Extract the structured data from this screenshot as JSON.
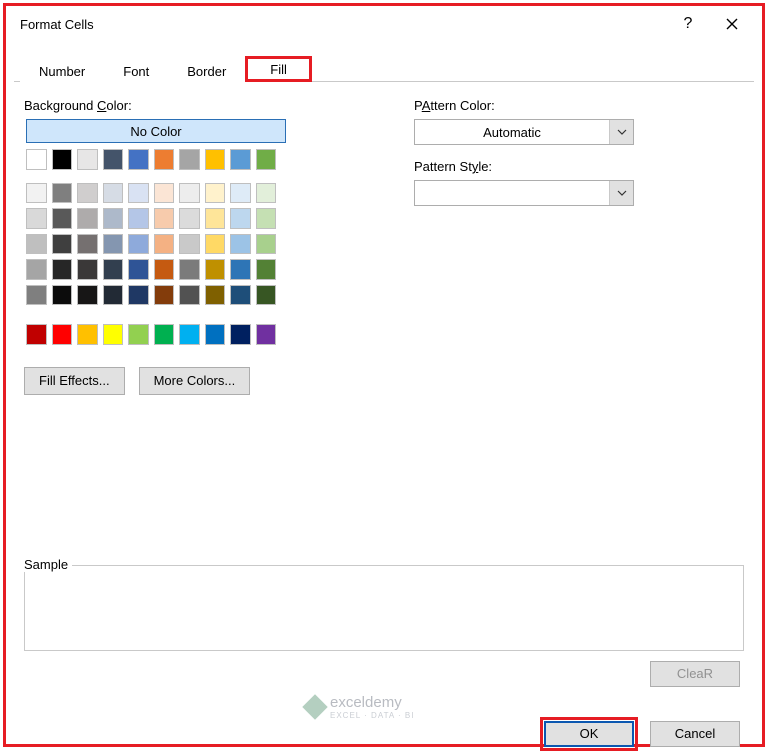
{
  "titlebar": {
    "title": "Format Cells",
    "help": "?",
    "close": "×"
  },
  "tabs": {
    "number": "Number",
    "font": "Font",
    "border": "Border",
    "fill": "Fill"
  },
  "left": {
    "bg_label_pre": "Background ",
    "bg_label_ul": "C",
    "bg_label_post": "olor:",
    "no_color": "No Color",
    "fill_effects_pre": "F",
    "fill_effects_ul": "i",
    "fill_effects_post": "ll Effects...",
    "more_colors_ul": "M",
    "more_colors_post": "ore Colors..."
  },
  "right": {
    "pattern_color_label": "Pattern Color:",
    "pattern_color_ul": "A",
    "pattern_color_value": "Automatic",
    "pattern_style_pre": "Pattern St",
    "pattern_style_ul": "y",
    "pattern_style_post": "le:",
    "pattern_style_value": ""
  },
  "sample": {
    "label": "Sample"
  },
  "buttons": {
    "clear_ul": "R",
    "clear_pre": "Clea",
    "clear_post": "",
    "ok": "OK",
    "cancel": "Cancel"
  },
  "watermark": {
    "name": "exceldemy",
    "sub": "EXCEL · DATA · BI"
  },
  "colors": {
    "theme_row": [
      "#ffffff",
      "#000000",
      "#e7e6e6",
      "#44546a",
      "#4472c4",
      "#ed7d31",
      "#a5a5a5",
      "#ffc000",
      "#5b9bd5",
      "#70ad47"
    ],
    "tints": [
      [
        "#f2f2f2",
        "#7f7f7f",
        "#d0cece",
        "#d6dce5",
        "#d9e2f3",
        "#fbe5d5",
        "#ededed",
        "#fff2cc",
        "#deebf7",
        "#e2efda"
      ],
      [
        "#d9d9d9",
        "#595959",
        "#aeabab",
        "#adb9ca",
        "#b4c6e7",
        "#f7cbac",
        "#dbdbdb",
        "#fee599",
        "#bdd7ee",
        "#c5e0b3"
      ],
      [
        "#bfbfbf",
        "#3f3f3f",
        "#757070",
        "#8496b0",
        "#8eaadb",
        "#f4b183",
        "#c9c9c9",
        "#ffd965",
        "#9cc3e6",
        "#a8d08d"
      ],
      [
        "#a5a5a5",
        "#262626",
        "#3a3838",
        "#323f4f",
        "#2f5496",
        "#c55a11",
        "#7b7b7b",
        "#bf9000",
        "#2e75b6",
        "#538135"
      ],
      [
        "#7f7f7f",
        "#0c0c0c",
        "#171616",
        "#222a35",
        "#1f3864",
        "#833c0b",
        "#525252",
        "#7f6000",
        "#1e4e79",
        "#375623"
      ]
    ],
    "standard": [
      "#c00000",
      "#ff0000",
      "#ffc000",
      "#ffff00",
      "#92d050",
      "#00b050",
      "#00b0f0",
      "#0070c0",
      "#002060",
      "#7030a0"
    ]
  }
}
